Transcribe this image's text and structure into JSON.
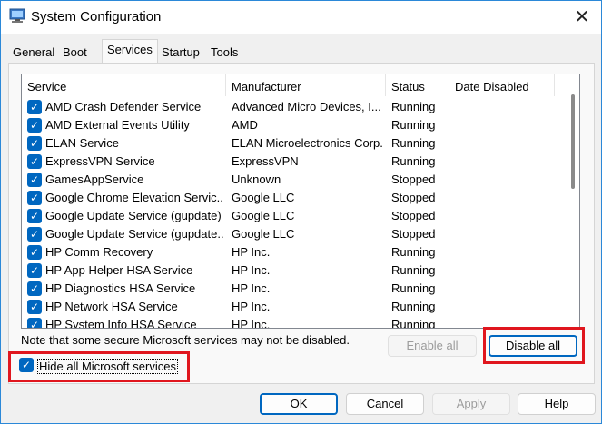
{
  "window": {
    "title": "System Configuration",
    "close_glyph": "✕",
    "app_icon": "system-config-icon"
  },
  "tabs": [
    {
      "label": "General",
      "selected": false
    },
    {
      "label": "Boot",
      "selected": false
    },
    {
      "label": "Services",
      "selected": true
    },
    {
      "label": "Startup",
      "selected": false
    },
    {
      "label": "Tools",
      "selected": false
    }
  ],
  "services_table": {
    "columns": [
      "Service",
      "Manufacturer",
      "Status",
      "Date Disabled"
    ],
    "rows": [
      {
        "checked": true,
        "service": "AMD Crash Defender Service",
        "manufacturer": "Advanced Micro Devices, I...",
        "status": "Running",
        "date_disabled": ""
      },
      {
        "checked": true,
        "service": "AMD External Events Utility",
        "manufacturer": "AMD",
        "status": "Running",
        "date_disabled": ""
      },
      {
        "checked": true,
        "service": "ELAN Service",
        "manufacturer": "ELAN Microelectronics Corp.",
        "status": "Running",
        "date_disabled": ""
      },
      {
        "checked": true,
        "service": "ExpressVPN Service",
        "manufacturer": "ExpressVPN",
        "status": "Running",
        "date_disabled": ""
      },
      {
        "checked": true,
        "service": "GamesAppService",
        "manufacturer": "Unknown",
        "status": "Stopped",
        "date_disabled": ""
      },
      {
        "checked": true,
        "service": "Google Chrome Elevation Servic...",
        "manufacturer": "Google LLC",
        "status": "Stopped",
        "date_disabled": ""
      },
      {
        "checked": true,
        "service": "Google Update Service (gupdate)",
        "manufacturer": "Google LLC",
        "status": "Stopped",
        "date_disabled": ""
      },
      {
        "checked": true,
        "service": "Google Update Service (gupdate...",
        "manufacturer": "Google LLC",
        "status": "Stopped",
        "date_disabled": ""
      },
      {
        "checked": true,
        "service": "HP Comm Recovery",
        "manufacturer": "HP Inc.",
        "status": "Running",
        "date_disabled": ""
      },
      {
        "checked": true,
        "service": "HP App Helper HSA Service",
        "manufacturer": "HP Inc.",
        "status": "Running",
        "date_disabled": ""
      },
      {
        "checked": true,
        "service": "HP Diagnostics HSA Service",
        "manufacturer": "HP Inc.",
        "status": "Running",
        "date_disabled": ""
      },
      {
        "checked": true,
        "service": "HP Network HSA Service",
        "manufacturer": "HP Inc.",
        "status": "Running",
        "date_disabled": ""
      },
      {
        "checked": true,
        "service": "HP System Info HSA Service",
        "manufacturer": "HP Inc.",
        "status": "Running",
        "date_disabled": ""
      }
    ]
  },
  "note": "Note that some secure Microsoft services may not be disabled.",
  "buttons": {
    "enable_all": {
      "label": "Enable all",
      "enabled": false
    },
    "disable_all": {
      "label": "Disable all",
      "enabled": true
    },
    "ok": "OK",
    "cancel": "Cancel",
    "apply": "Apply",
    "help": "Help"
  },
  "hide_ms": {
    "label": "Hide all Microsoft services",
    "checked": true
  },
  "check_glyph": "✓",
  "colors": {
    "accent": "#0067c0",
    "highlight": "#e0161e",
    "window_border": "#2b88d8"
  }
}
